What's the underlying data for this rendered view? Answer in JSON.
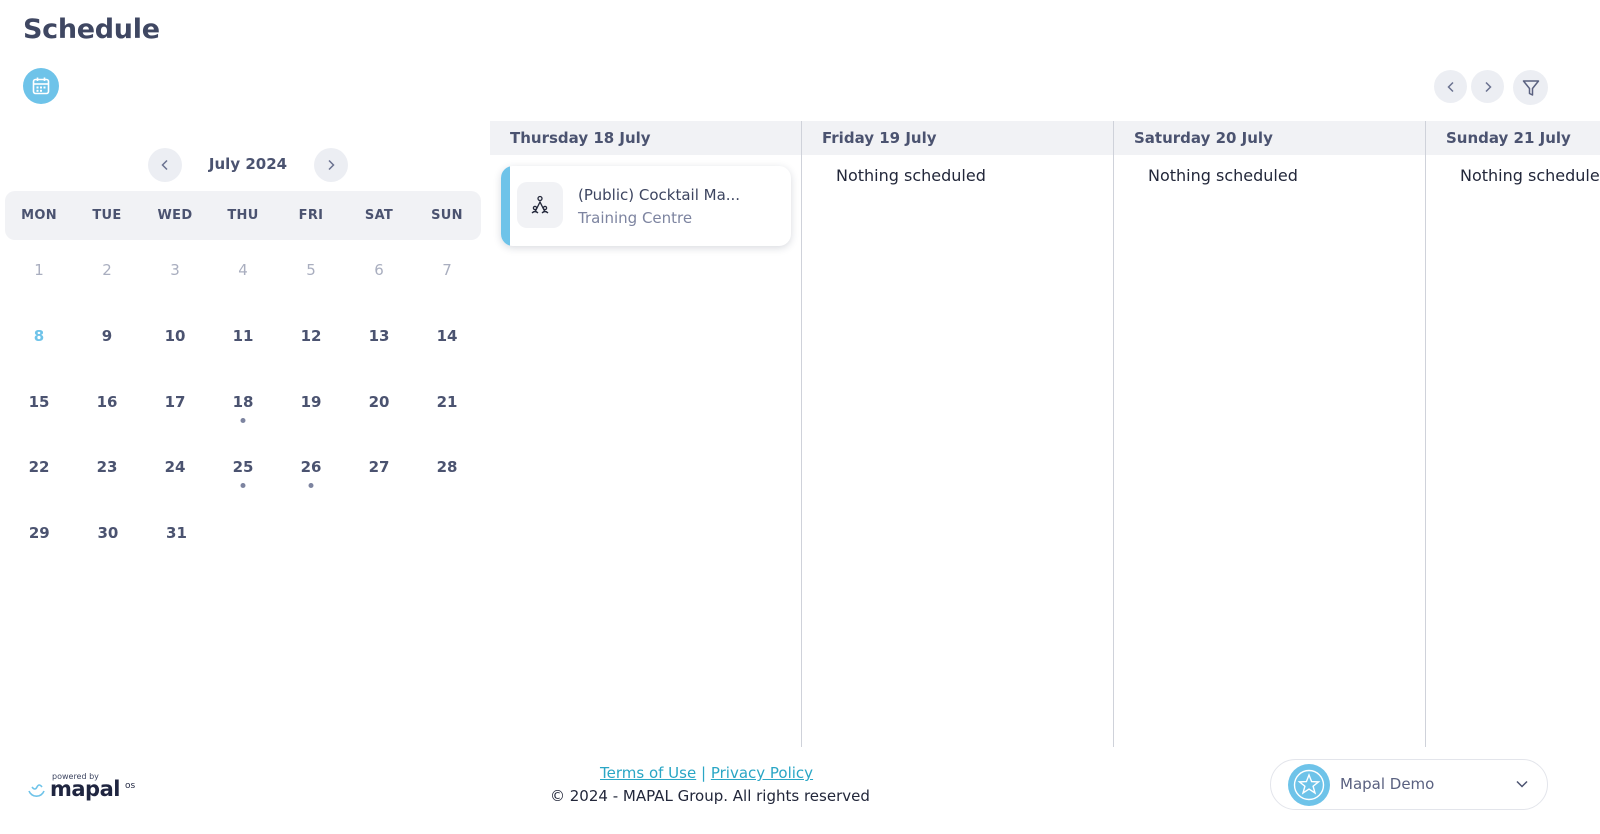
{
  "header": {
    "title": "Schedule"
  },
  "icons": {
    "calendar_toggle": "calendar-icon",
    "prev": "chevron-left-icon",
    "next": "chevron-right-icon",
    "filter": "filter-icon",
    "event": "training-icon",
    "avatar": "star-icon",
    "account_menu": "chevron-down-icon"
  },
  "colors": {
    "accent": "#6ec3e9",
    "link": "#2aa6c5",
    "text": "#3d4560",
    "muted": "#a9aebf"
  },
  "mini_calendar": {
    "month_label": "July 2024",
    "weekdays": [
      "MON",
      "TUE",
      "WED",
      "THU",
      "FRI",
      "SAT",
      "SUN"
    ],
    "weeks": [
      [
        {
          "d": "1",
          "state": "muted"
        },
        {
          "d": "2",
          "state": "muted"
        },
        {
          "d": "3",
          "state": "muted"
        },
        {
          "d": "4",
          "state": "muted"
        },
        {
          "d": "5",
          "state": "muted"
        },
        {
          "d": "6",
          "state": "muted"
        },
        {
          "d": "7",
          "state": "muted"
        }
      ],
      [
        {
          "d": "8",
          "state": "today"
        },
        {
          "d": "9"
        },
        {
          "d": "10"
        },
        {
          "d": "11"
        },
        {
          "d": "12"
        },
        {
          "d": "13"
        },
        {
          "d": "14"
        }
      ],
      [
        {
          "d": "15"
        },
        {
          "d": "16"
        },
        {
          "d": "17"
        },
        {
          "d": "18",
          "state": "selected",
          "dot": true
        },
        {
          "d": "19"
        },
        {
          "d": "20"
        },
        {
          "d": "21"
        }
      ],
      [
        {
          "d": "22"
        },
        {
          "d": "23"
        },
        {
          "d": "24"
        },
        {
          "d": "25",
          "dot": true
        },
        {
          "d": "26",
          "dot": true
        },
        {
          "d": "27"
        },
        {
          "d": "28"
        }
      ],
      [
        {
          "d": "29"
        },
        {
          "d": "30"
        },
        {
          "d": "31"
        }
      ]
    ]
  },
  "schedule": {
    "days": [
      {
        "label": "Thursday 18 July",
        "events": [
          {
            "title": "(Public) Cocktail Ma...",
            "location": "Training Centre"
          }
        ]
      },
      {
        "label": "Friday 19 July",
        "empty_text": "Nothing scheduled"
      },
      {
        "label": "Saturday 20 July",
        "empty_text": "Nothing scheduled"
      },
      {
        "label": "Sunday 21 July",
        "empty_text": "Nothing scheduled"
      }
    ]
  },
  "footer": {
    "powered_by": "powered by",
    "brand": "mapal",
    "brand_suffix": "os",
    "terms": "Terms of Use",
    "separator": "|",
    "privacy": "Privacy Policy",
    "copyright": "© 2024 - MAPAL Group. All rights reserved"
  },
  "account": {
    "name": "Mapal Demo"
  }
}
